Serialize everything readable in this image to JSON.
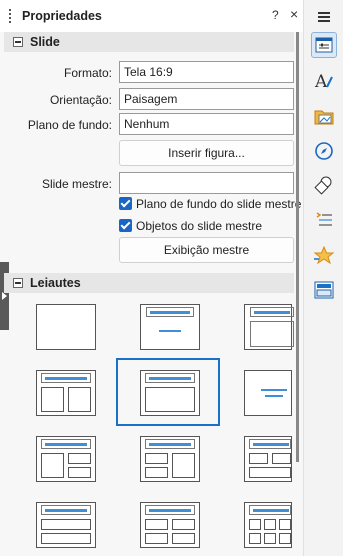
{
  "panel": {
    "title": "Propriedades",
    "help_label": "?",
    "close_label": "×"
  },
  "slide": {
    "heading": "Slide",
    "format_label": "Formato:",
    "format_value": "Tela 16:9",
    "orientation_label": "Orientação:",
    "orientation_value": "Paisagem",
    "background_label": "Plano de fundo:",
    "background_value": "Nenhum",
    "insert_image_label": "Inserir figura...",
    "master_label": "Slide mestre:",
    "master_value": "",
    "master_bg_label": "Plano de fundo do slide mestre",
    "master_objects_label": "Objetos do slide mestre",
    "master_view_label": "Exibição mestre"
  },
  "layouts": {
    "heading": "Leiautes"
  },
  "colors": {
    "accent": "#1a72c8",
    "bar": "#3d8fd8"
  },
  "deck_icons": [
    "properties-icon",
    "styles-icon",
    "gallery-icon",
    "navigator-icon",
    "shapes-icon",
    "animation-icon",
    "transition-icon",
    "master-slides-icon"
  ]
}
